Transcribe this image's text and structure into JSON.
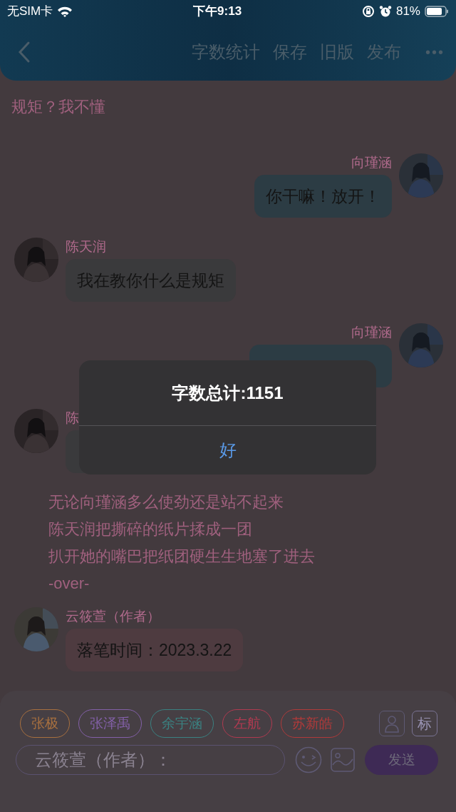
{
  "status_bar": {
    "carrier": "无SIM卡",
    "time": "下午9:13",
    "battery": "81%"
  },
  "nav": {
    "actions": [
      "字数统计",
      "保存",
      "旧版",
      "发布"
    ],
    "more": "•••"
  },
  "chat": [
    {
      "kind": "caption",
      "text": "规矩？我不懂"
    },
    {
      "kind": "outgoing",
      "name": "向瑾涵",
      "text": "你干嘛！放开！"
    },
    {
      "kind": "incoming",
      "name": "陈天润",
      "text": "我在教你什么是规矩"
    },
    {
      "kind": "outgoing",
      "name": "向瑾涵"
    },
    {
      "kind": "incoming",
      "name": "陈"
    },
    {
      "kind": "narration",
      "text": "无论向瑾涵多么使劲还是站不起来"
    },
    {
      "kind": "narration",
      "text": "陈天润把撕碎的纸片揉成一团"
    },
    {
      "kind": "narration",
      "text": "扒开她的嘴巴把纸团硬生生地塞了进去"
    },
    {
      "kind": "narration",
      "text": "-over-"
    },
    {
      "kind": "author",
      "name": "云筱萱（作者）",
      "text": "落笔时间：2023.3.22"
    }
  ],
  "dialog": {
    "title": "字数总计:1151",
    "button": "好"
  },
  "composer": {
    "tags": [
      {
        "label": "张极",
        "color": "#a8703f"
      },
      {
        "label": "张泽禹",
        "color": "#8360a8"
      },
      {
        "label": "余宇涵",
        "color": "#3a8282"
      },
      {
        "label": "左航",
        "color": "#b03a50"
      },
      {
        "label": "苏新皓",
        "color": "#b03a3a"
      }
    ],
    "mark_button": "标",
    "placeholder": "云筱萱（作者）：",
    "send": "发送"
  }
}
